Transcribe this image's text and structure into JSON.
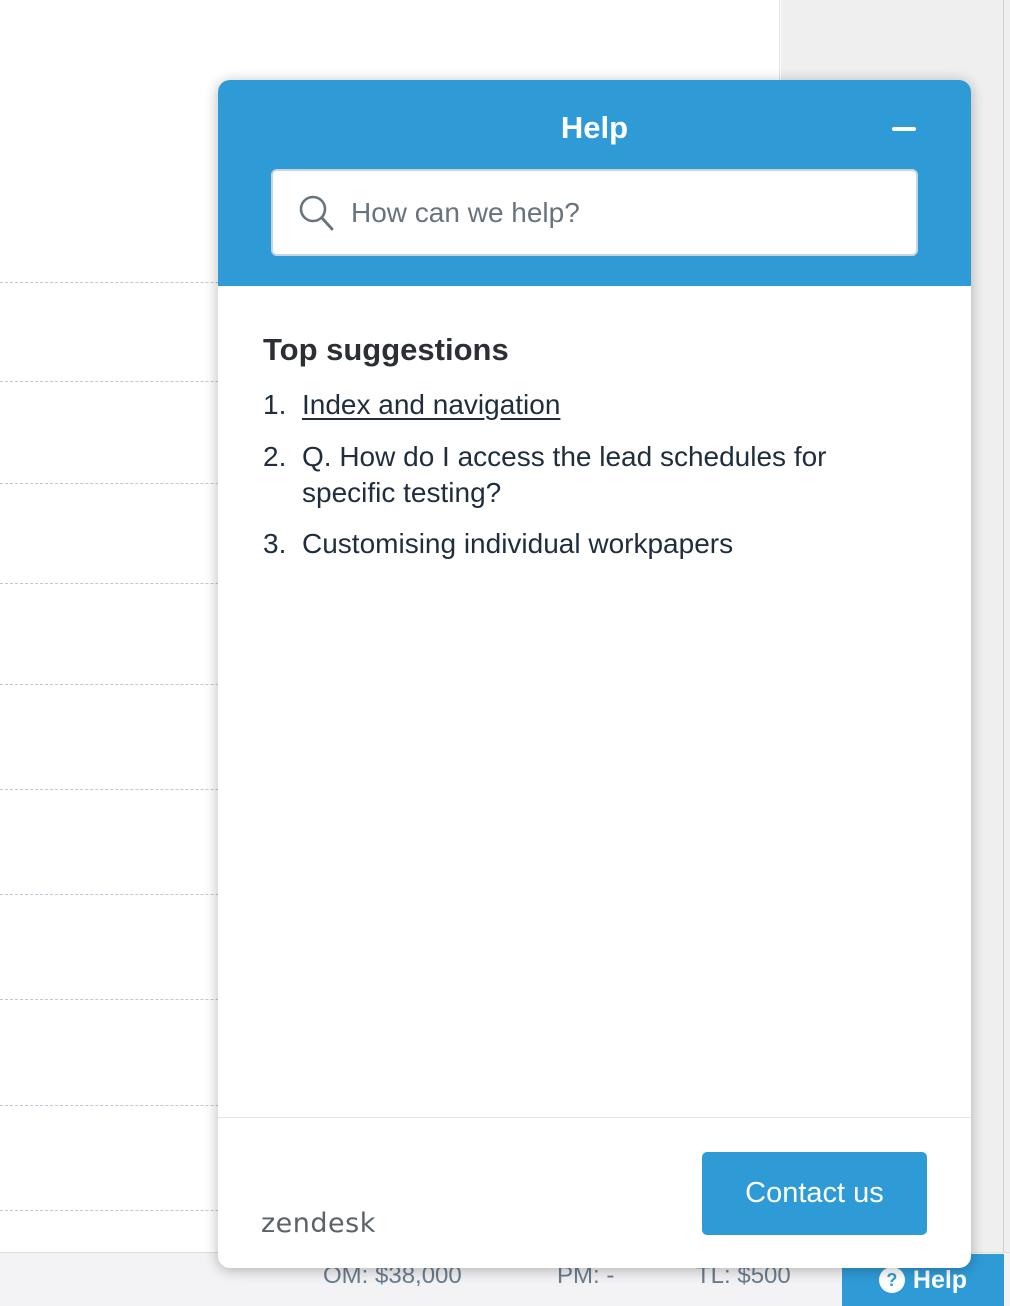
{
  "widget": {
    "title": "Help",
    "search": {
      "placeholder": "How can we help?",
      "value": ""
    },
    "suggestions_heading": "Top suggestions",
    "suggestions": [
      {
        "number": "1.",
        "text": "Index and navigation"
      },
      {
        "number": "2.",
        "text": "Q. How do I access the lead schedules for specific testing?"
      },
      {
        "number": "3.",
        "text": "Customising individual workpapers"
      }
    ],
    "contact_label": "Contact us",
    "brand": "zendesk"
  },
  "status_bar": {
    "om": "OM: $38,000",
    "pm": "PM: -",
    "tl": "TL: $500",
    "help_label": "Help",
    "help_icon_glyph": "?"
  },
  "colors": {
    "accent": "#2f9bd6",
    "text": "#1f2d3d"
  }
}
